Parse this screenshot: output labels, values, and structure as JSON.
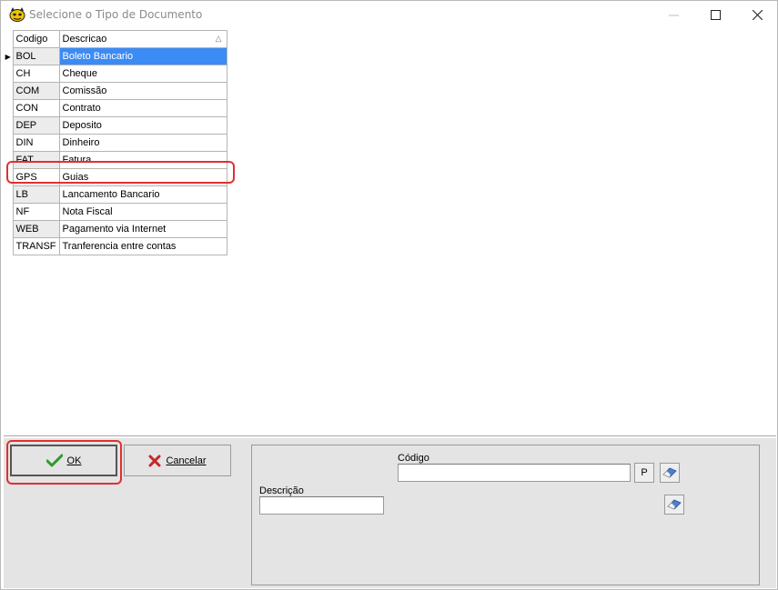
{
  "window": {
    "title": "Selecione o Tipo de Documento",
    "buttons": {
      "minimize": "—",
      "maximize": "☐",
      "close": "✕"
    }
  },
  "grid": {
    "columns": [
      "Codigo",
      "Descricao"
    ],
    "sort_indicator": "△",
    "current_row_marker": "▶",
    "selected_index": 0,
    "highlighted_index": 5,
    "rows": [
      {
        "code": "BOL",
        "desc": "Boleto Bancario"
      },
      {
        "code": "CH",
        "desc": "Cheque"
      },
      {
        "code": "COM",
        "desc": "Comissão"
      },
      {
        "code": "CON",
        "desc": "Contrato"
      },
      {
        "code": "DEP",
        "desc": "Deposito"
      },
      {
        "code": "DIN",
        "desc": "Dinheiro"
      },
      {
        "code": "FAT",
        "desc": "Fatura"
      },
      {
        "code": "GPS",
        "desc": "Guias"
      },
      {
        "code": "LB",
        "desc": "Lancamento Bancario"
      },
      {
        "code": "NF",
        "desc": "Nota Fiscal"
      },
      {
        "code": "WEB",
        "desc": "Pagamento via Internet"
      },
      {
        "code": "TRANSF",
        "desc": "Tranferencia entre contas"
      }
    ]
  },
  "actions": {
    "ok_label": "OK",
    "cancel_label": "Cancelar"
  },
  "filters": {
    "codigo_label": "Código",
    "codigo_value": "",
    "search_button": "P",
    "descricao_label": "Descrição",
    "descricao_value": ""
  },
  "colors": {
    "selection": "#3b8bf5",
    "highlight": "#e03030",
    "ok_check": "#2e9a2e",
    "cancel_x": "#c62828"
  }
}
